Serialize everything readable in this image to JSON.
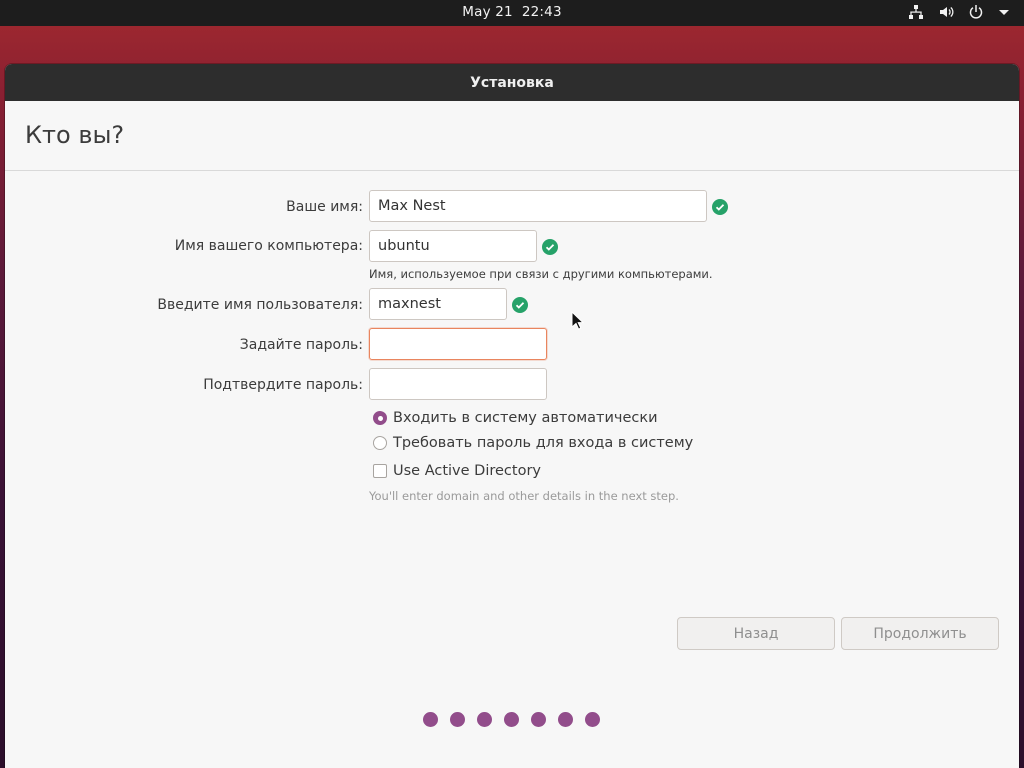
{
  "topbar": {
    "date": "May 21",
    "time": "22:43",
    "icons": [
      "network-icon",
      "volume-icon",
      "power-icon",
      "chevron-down-icon"
    ]
  },
  "window": {
    "title": "Установка"
  },
  "page": {
    "heading": "Кто вы?"
  },
  "form": {
    "name_label": "Ваше имя:",
    "name_value": "Max Nest",
    "computer_label": "Имя вашего компьютера:",
    "computer_value": "ubuntu",
    "computer_hint": "Имя, используемое при связи с другими компьютерами.",
    "username_label": "Введите имя пользователя:",
    "username_value": "maxnest",
    "password_label": "Задайте пароль:",
    "password_value": "",
    "confirm_label": "Подтвердите пароль:",
    "confirm_value": ""
  },
  "options": {
    "auto_login": "Входить в систему автоматически",
    "require_password": "Требовать пароль для входа в систему",
    "selected": "auto_login",
    "active_directory": "Use Active Directory",
    "active_directory_checked": false,
    "active_directory_hint": "You'll enter domain and other details in the next step."
  },
  "buttons": {
    "back": "Назад",
    "continue": "Продолжить"
  },
  "progress": {
    "dots": 7
  },
  "colors": {
    "accent": "#924d8b",
    "valid": "#26a269",
    "focus": "#e9855e",
    "titlebar": "#2d2d2d"
  }
}
